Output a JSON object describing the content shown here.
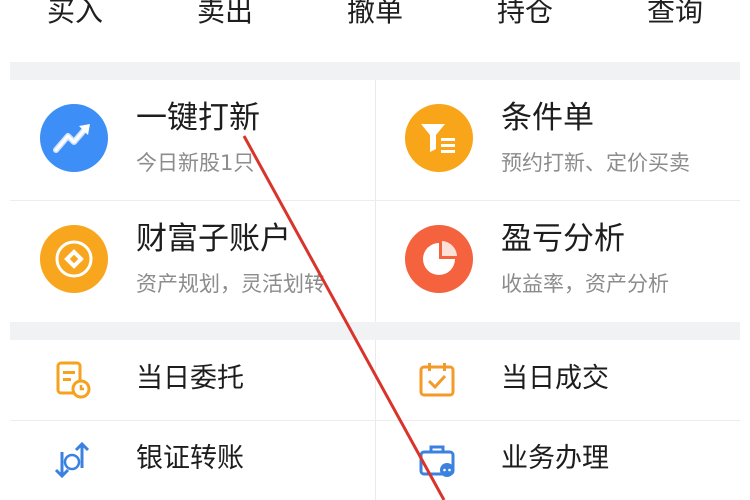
{
  "top_tabs": [
    "买入",
    "卖出",
    "撤单",
    "持仓",
    "查询"
  ],
  "features": [
    {
      "title": "一键打新",
      "subtitle": "今日新股1只",
      "icon": "rocket-trend-icon",
      "color": "#3d8ef6"
    },
    {
      "title": "条件单",
      "subtitle": "预约打新、定价买卖",
      "icon": "funnel-icon",
      "color": "#f9a51a"
    },
    {
      "title": "财富子账户",
      "subtitle": "资产规划，灵活划转",
      "icon": "coin-icon",
      "color": "#f8a61e"
    },
    {
      "title": "盈亏分析",
      "subtitle": "收益率，资产分析",
      "icon": "pie-chart-icon",
      "color": "#f4623e"
    }
  ],
  "quick_items": [
    {
      "title": "当日委托",
      "icon": "entrust-document-icon"
    },
    {
      "title": "当日成交",
      "icon": "calendar-check-icon"
    },
    {
      "title": "银证转账",
      "icon": "bank-transfer-icon"
    },
    {
      "title": "业务办理",
      "icon": "briefcase-icon"
    }
  ],
  "colors": {
    "blue": "#3d8ef6",
    "orange": "#f9a51a",
    "red": "#f4623e",
    "annotation": "#d9342b"
  }
}
